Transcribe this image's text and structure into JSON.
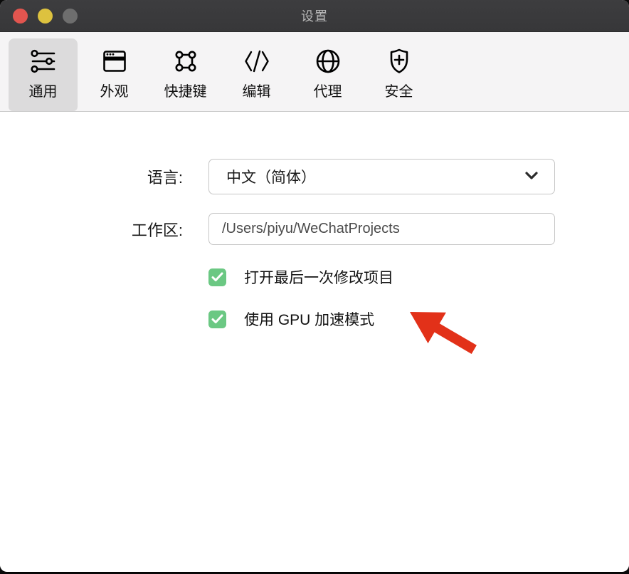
{
  "titlebar": {
    "title": "设置",
    "traffic_lights": [
      "close",
      "minimize",
      "zoom-disabled"
    ]
  },
  "toolbar": {
    "tabs": [
      {
        "label": "通用",
        "icon": "sliders-icon",
        "selected": true
      },
      {
        "label": "外观",
        "icon": "app-window-icon",
        "selected": false
      },
      {
        "label": "快捷键",
        "icon": "frame-icon",
        "selected": false
      },
      {
        "label": "编辑",
        "icon": "code-icon",
        "selected": false
      },
      {
        "label": "代理",
        "icon": "globe-icon",
        "selected": false
      },
      {
        "label": "安全",
        "icon": "shield-plus-icon",
        "selected": false
      }
    ]
  },
  "form": {
    "language": {
      "label": "语言:",
      "value": "中文（简体）"
    },
    "workspace": {
      "label": "工作区:",
      "value": "/Users/piyu/WeChatProjects"
    },
    "options": [
      {
        "label": "打开最后一次修改项目",
        "checked": true
      },
      {
        "label": "使用 GPU 加速模式",
        "checked": true
      }
    ]
  },
  "annotation": {
    "shape": "red-arrow",
    "points_at": "使用 GPU 加速模式"
  },
  "colors": {
    "titlebar_bg": "#3a3a3c",
    "title_text": "#b8b8b8",
    "traffic_red": "#e2554f",
    "traffic_yellow": "#ddc23f",
    "traffic_gray": "#6e6e6e",
    "toolbar_bg": "#f5f4f5",
    "tab_selected_bg": "#dcdbdc",
    "field_border": "#c6c6c6",
    "checkbox_green": "#6bc883",
    "arrow_red": "#e23119"
  }
}
